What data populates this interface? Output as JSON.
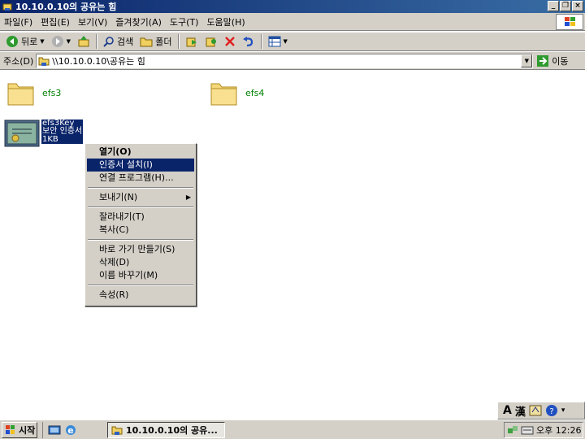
{
  "window": {
    "title": "10.10.0.10의 공유는 힘"
  },
  "menubar": {
    "items": [
      "파일(F)",
      "편집(E)",
      "보기(V)",
      "즐겨찾기(A)",
      "도구(T)",
      "도움말(H)"
    ]
  },
  "toolbar": {
    "back_label": "뒤로",
    "search_label": "검색",
    "folders_label": "폴더"
  },
  "address": {
    "label": "주소(D)",
    "value": "\\\\10.10.0.10\\공유는 힘",
    "go_label": "이동"
  },
  "content": {
    "folders": [
      {
        "name": "efs3"
      },
      {
        "name": "efs4"
      }
    ],
    "certificate": {
      "name": "efs3Key",
      "type": "보안 인증서",
      "size": "1KB"
    }
  },
  "context_menu": {
    "items": [
      "열기(O)",
      "인증서 설치(I)",
      "연결 프로그램(H)...",
      "보내기(N)",
      "잘라내기(T)",
      "복사(C)",
      "바로 가기 만들기(S)",
      "삭제(D)",
      "이름 바꾸기(M)",
      "속성(R)"
    ]
  },
  "langbar": {
    "mode": "A",
    "hanja": "漢"
  },
  "taskbar": {
    "start_label": "시작",
    "task_label": "10.10.0.10의 공유...",
    "clock": "오후 12:26"
  },
  "colors": {
    "titlebar": "#0a246a",
    "selection": "#0a246a",
    "file_label": "#008000",
    "chrome": "#d4d0c8"
  }
}
